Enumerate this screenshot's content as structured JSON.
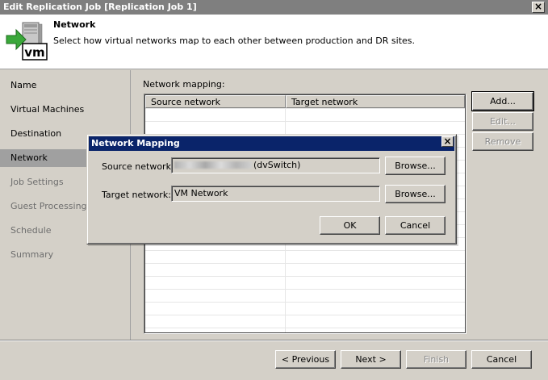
{
  "window": {
    "title": "Edit Replication Job [Replication Job 1]",
    "close_glyph": "×"
  },
  "header": {
    "title": "Network",
    "description": "Select how virtual networks map to each other between production and DR sites.",
    "icon": "vm-server-arrow-icon",
    "icon_label": "vm",
    "accent_color": "#3aa83a"
  },
  "sidebar": {
    "items": [
      {
        "label": "Name",
        "state": "done"
      },
      {
        "label": "Virtual Machines",
        "state": "done"
      },
      {
        "label": "Destination",
        "state": "done"
      },
      {
        "label": "Network",
        "state": "active"
      },
      {
        "label": "Job Settings",
        "state": "inactive"
      },
      {
        "label": "Guest Processing",
        "state": "inactive"
      },
      {
        "label": "Schedule",
        "state": "inactive"
      },
      {
        "label": "Summary",
        "state": "inactive"
      }
    ]
  },
  "content": {
    "mapping_label": "Network mapping:",
    "columns": [
      "Source network",
      "Target network"
    ],
    "buttons": {
      "add": "Add...",
      "edit": "Edit...",
      "remove": "Remove"
    }
  },
  "footer": {
    "previous": "< Previous",
    "next": "Next >",
    "finish": "Finish",
    "cancel": "Cancel"
  },
  "dialog": {
    "title": "Network Mapping",
    "close_glyph": "×",
    "source_label": "Source network:",
    "source_value_suffix": "(dvSwitch)",
    "source_value_redacted": true,
    "target_label": "Target network:",
    "target_value": "VM Network",
    "browse": "Browse...",
    "ok": "OK",
    "cancel": "Cancel",
    "title_color": "#0a246a"
  }
}
